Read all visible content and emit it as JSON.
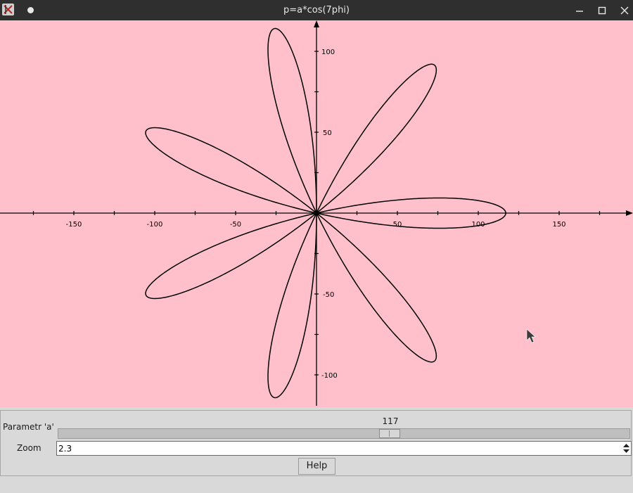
{
  "window": {
    "title": "p=a*cos(7phi)"
  },
  "plot": {
    "x_ticks": [
      "-150",
      "-100",
      "-50",
      "50",
      "100",
      "150"
    ],
    "y_ticks": [
      "100",
      "50",
      "-50",
      "-100"
    ],
    "curve": {
      "formula": "r = a*cos(7*phi)",
      "petals": 7,
      "a": 117
    }
  },
  "controls": {
    "param_label": "Parametr 'a'",
    "param_value": "117",
    "zoom_label": "Zoom",
    "zoom_value": "2.3",
    "help_label": "Help"
  },
  "colors": {
    "plot_background": "#ffc0cb",
    "curve": "#000000",
    "titlebar": "#2f2f2f"
  }
}
